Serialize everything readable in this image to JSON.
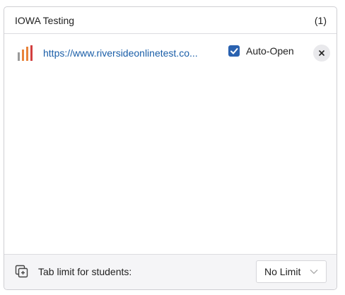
{
  "panel": {
    "title": "IOWA Testing",
    "count": "(1)"
  },
  "tabs": [
    {
      "url": "https://www.riversideonlinetest.co...",
      "icon": "bar-chart-site-icon",
      "auto_open_label": "Auto-Open",
      "auto_open_checked": true
    }
  ],
  "footer": {
    "icon": "tabs-stack-icon",
    "label": "Tab limit for students:",
    "select_value": "No Limit"
  },
  "colors": {
    "link": "#1a5ea8",
    "checkbox": "#2a62b0",
    "bar_gray": "#9a9a9a",
    "bar_orange": "#e8833a",
    "bar_red": "#d23f3f"
  }
}
